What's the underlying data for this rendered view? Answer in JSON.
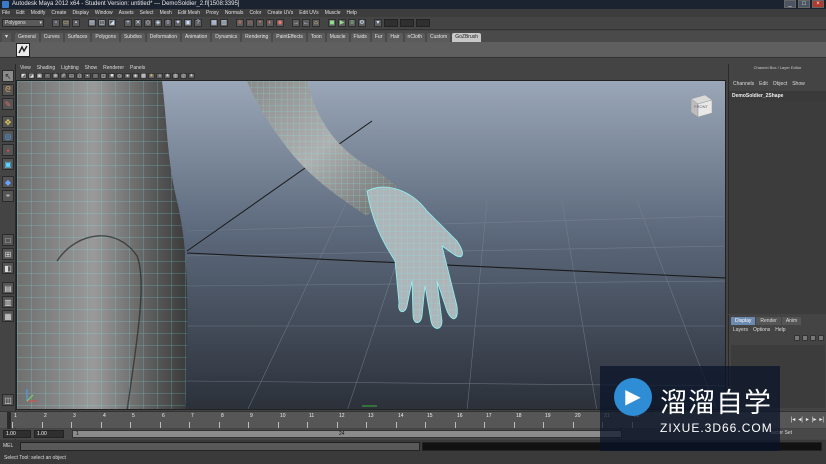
{
  "window": {
    "title": "Autodesk Maya 2012 x64 - Student Version: untitled*   ---   DemoSoldier_2.fl[1508:3395]",
    "controls": [
      "_",
      "□",
      "×"
    ]
  },
  "menus": [
    "File",
    "Edit",
    "Modify",
    "Create",
    "Display",
    "Window",
    "Assets",
    "Select",
    "Mesh",
    "Edit Mesh",
    "Proxy",
    "Normals",
    "Color",
    "Create UVs",
    "Edit UVs",
    "Muscle",
    "Help"
  ],
  "status_line": {
    "mode": "Polygons"
  },
  "shelf": {
    "tabs": [
      "General",
      "Curves",
      "Surfaces",
      "Polygons",
      "Subdivs",
      "Deformation",
      "Animation",
      "Dynamics",
      "Rendering",
      "PaintEffects",
      "Toon",
      "Muscle",
      "Fluids",
      "Fur",
      "Hair",
      "nCloth",
      "Custom",
      "GoZBrush"
    ],
    "active_tab": "GoZBrush",
    "icons": [
      "gozbrush-icon"
    ]
  },
  "panel": {
    "menus": [
      "View",
      "Shading",
      "Lighting",
      "Show",
      "Renderer",
      "Panels"
    ]
  },
  "viewport": {
    "viewcube_label": "FRONT",
    "background_top": "#9aa7b8",
    "background_bottom": "#2b3039"
  },
  "channel_box": {
    "title": "Channel Box / Layer Editor",
    "menus": [
      "Channels",
      "Edit",
      "Object",
      "Show"
    ],
    "object_name": "DemoSoldier_2Shape"
  },
  "layer_editor": {
    "tabs": [
      "Display",
      "Render",
      "Anim"
    ],
    "active_tab": "Display",
    "menus": [
      "Layers",
      "Options",
      "Help"
    ]
  },
  "time_slider": {
    "ticks": [
      "1",
      "2",
      "3",
      "4",
      "5",
      "6",
      "7",
      "8",
      "9",
      "10",
      "11",
      "12",
      "13",
      "14",
      "15",
      "16",
      "17",
      "18",
      "19",
      "20",
      "21",
      "22"
    ],
    "current_frame": 1
  },
  "range_slider": {
    "start": "1.00",
    "anim_start": "1.00",
    "range_start": "1",
    "range_end": "24",
    "character_set": "racter Set"
  },
  "command_line": {
    "lang": "MEL"
  },
  "help_line": {
    "text": "Select Tool: select an object"
  },
  "watermark": {
    "title": "溜溜自学",
    "url": "ZIXUE.3D66.COM",
    "color": "#2f8dd6"
  }
}
